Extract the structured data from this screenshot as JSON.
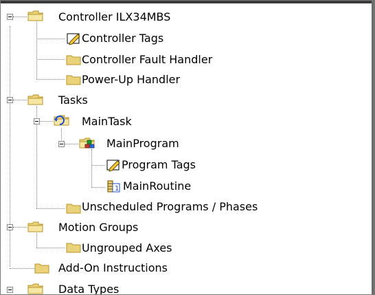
{
  "tree": {
    "nodes": [
      {
        "label": "Controller ILX34MBS",
        "icon": "folder-open-icon",
        "expanded": true
      },
      {
        "label": "Controller Tags",
        "icon": "tags-icon"
      },
      {
        "label": "Controller Fault Handler",
        "icon": "folder-icon"
      },
      {
        "label": "Power-Up Handler",
        "icon": "folder-icon"
      },
      {
        "label": "Tasks",
        "icon": "folder-open-icon",
        "expanded": true
      },
      {
        "label": "MainTask",
        "icon": "task-icon",
        "expanded": true
      },
      {
        "label": "MainProgram",
        "icon": "program-icon",
        "expanded": true
      },
      {
        "label": "Program Tags",
        "icon": "tags-icon"
      },
      {
        "label": "MainRoutine",
        "icon": "routine-icon"
      },
      {
        "label": "Unscheduled Programs / Phases",
        "icon": "folder-icon"
      },
      {
        "label": "Motion Groups",
        "icon": "folder-open-icon",
        "expanded": true
      },
      {
        "label": "Ungrouped Axes",
        "icon": "folder-icon"
      },
      {
        "label": "Add-On Instructions",
        "icon": "folder-icon"
      },
      {
        "label": "Data Types",
        "icon": "folder-open-icon",
        "expanded": true
      }
    ]
  },
  "colors": {
    "folder": "#e9d27a",
    "folder_dark": "#b8962a",
    "task_blue": "#1e4fd1",
    "program_green": "#1a9a2f"
  }
}
